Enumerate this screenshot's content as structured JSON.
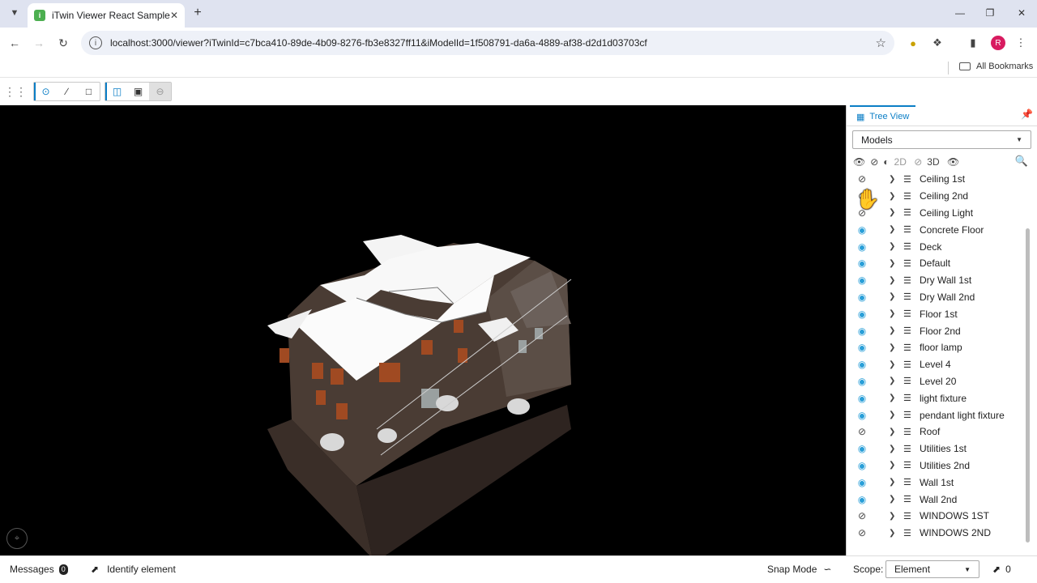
{
  "browser": {
    "tab_title": "iTwin Viewer React Sample",
    "url": "localhost:3000/viewer?iTwinId=c7bca410-89de-4b09-8276-fb3e8327ff11&iModelId=1f508791-da6a-4889-af38-d2d1d03703cf",
    "profile_initial": "R",
    "bookmarks_label": "All Bookmarks"
  },
  "panel": {
    "tab_label": "Tree View",
    "dropdown_value": "Models",
    "vis_2d": "2D",
    "vis_3d": "3D",
    "models": [
      {
        "name": "Ceiling 1st",
        "visible": false
      },
      {
        "name": "Ceiling 2nd",
        "visible": false
      },
      {
        "name": "Ceiling Light",
        "visible": false
      },
      {
        "name": "Concrete Floor",
        "visible": true
      },
      {
        "name": "Deck",
        "visible": true
      },
      {
        "name": "Default",
        "visible": true
      },
      {
        "name": "Dry Wall 1st",
        "visible": true
      },
      {
        "name": "Dry Wall 2nd",
        "visible": true
      },
      {
        "name": "Floor 1st",
        "visible": true
      },
      {
        "name": "Floor 2nd",
        "visible": true
      },
      {
        "name": "floor lamp",
        "visible": true
      },
      {
        "name": "Level 4",
        "visible": true
      },
      {
        "name": "Level 20",
        "visible": true
      },
      {
        "name": "light fixture",
        "visible": true
      },
      {
        "name": "pendant light fixture",
        "visible": true
      },
      {
        "name": "Roof",
        "visible": false
      },
      {
        "name": "Utilities 1st",
        "visible": true
      },
      {
        "name": "Utilities 2nd",
        "visible": true
      },
      {
        "name": "Wall 1st",
        "visible": true
      },
      {
        "name": "Wall 2nd",
        "visible": true
      },
      {
        "name": "WINDOWS 1ST",
        "visible": false
      },
      {
        "name": "WINDOWS 2ND",
        "visible": false
      }
    ]
  },
  "status": {
    "messages_label": "Messages",
    "messages_count": "0",
    "identify_label": "Identify element",
    "snap_label": "Snap Mode",
    "scope_label": "Scope:",
    "scope_value": "Element",
    "selection_count": "0"
  },
  "colors": {
    "accent": "#0b7ec6",
    "eye_visible": "#2a9fd8"
  }
}
